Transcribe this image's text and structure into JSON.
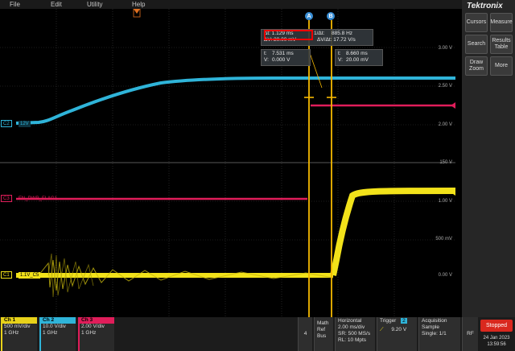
{
  "menu": {
    "items": [
      "File",
      "Edit",
      "Utility",
      "Help"
    ]
  },
  "brand": "Tektronix",
  "side_buttons": [
    {
      "name": "cursors",
      "label": "Cursors"
    },
    {
      "name": "measure",
      "label": "Measure"
    },
    {
      "name": "search",
      "label": "Search"
    },
    {
      "name": "results-table",
      "label": "Results\nTable"
    },
    {
      "name": "draw-zoom",
      "label": "Draw\nZoom"
    },
    {
      "name": "more",
      "label": "More"
    }
  ],
  "scale_labels": {
    "upper": [
      "3.00 V",
      "2.50 V",
      "2.00 V",
      "150 V"
    ],
    "lower": [
      "1.00 V",
      "500 mV",
      "0.00 V"
    ]
  },
  "cursors": {
    "a_label": "A",
    "b_label": "B",
    "delta_t": "Δt: 1.129 ms",
    "inv_delta_t": "1/Δt:",
    "inv_delta_t_value": "885.8 Hz",
    "delta_v": "ΔV: 20.00 mV",
    "delta_v_dt": "ΔV/Δt: 17.72 V/s",
    "a_t": "t:",
    "a_t_value": "7.531 ms",
    "a_v": "V:",
    "a_v_value": "0.000 V",
    "b_t": "t:",
    "b_t_value": "8.660 ms",
    "b_v": "V:",
    "b_v_value": "20.00 mV"
  },
  "channel_labels": {
    "c2_tag": "C2",
    "c2_name": "12V",
    "c3_tag": "C3",
    "c3_name": "EN_PWR_FLAG1",
    "c1_tag": "C1",
    "c1_name": "1.1V_C5"
  },
  "bottom": {
    "ch1": {
      "title": "Ch 1",
      "scale": "500 mV/div",
      "bw": "1 GHz",
      "color": "#e8d21a"
    },
    "ch2": {
      "title": "Ch 2",
      "scale": "10.0 V/div",
      "bw": "1 GHz",
      "color": "#2fb4d9"
    },
    "ch3": {
      "title": "Ch 3",
      "scale": "2.00 V/div",
      "bw": "1 GHz",
      "color": "#e01d5a"
    },
    "num": "4",
    "math": "Math\nRef\nBus",
    "horizontal": {
      "title": "Horizontal",
      "line1": "2.00 ms/div",
      "line2": "SR: 500 MS/s",
      "line3": "RL: 10 Mpts"
    },
    "trigger": {
      "title": "Trigger",
      "badge": "2",
      "value": "9.20 V"
    },
    "acquisition": {
      "title": "Acquisition",
      "line1": "Sample",
      "line2": "Single: 1/1"
    },
    "rf": "RF",
    "stopped": "Stopped",
    "date": "24 Jan 2023",
    "time": "13:59:56"
  },
  "colors": {
    "ch1": "#f2e21a",
    "ch2": "#2fb4d9",
    "ch3": "#e01d5a",
    "cursor": "#f5b800"
  }
}
